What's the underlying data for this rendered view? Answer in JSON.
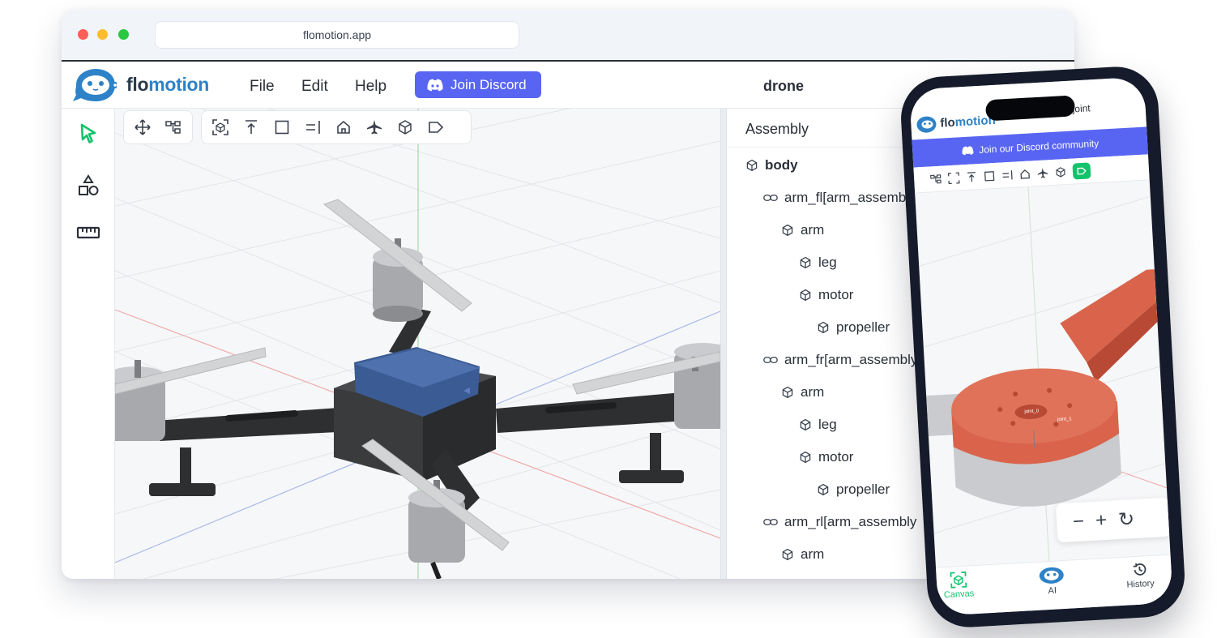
{
  "browser": {
    "url": "flomotion.app"
  },
  "app": {
    "brand_part1": "flo",
    "brand_part2": "motion",
    "menu": [
      "File",
      "Edit",
      "Help"
    ],
    "discord_label": "Join Discord",
    "doc_title": "drone"
  },
  "left_tools": [
    "select-cursor-icon",
    "shapes-icon",
    "ruler-icon"
  ],
  "toolbar": {
    "group1": [
      "move-icon",
      "hierarchy-icon"
    ],
    "group2": [
      "fit-view-icon",
      "top-view-icon",
      "front-view-icon",
      "side-view-icon",
      "home-view-icon",
      "plane-view-icon",
      "iso-cube-icon",
      "tag-icon"
    ]
  },
  "tree": {
    "header": "Assembly",
    "nodes": [
      {
        "label": "body",
        "type": "part",
        "level": 0,
        "bold": true
      },
      {
        "label": "arm_fl[arm_assembly",
        "type": "link",
        "level": 1
      },
      {
        "label": "arm",
        "type": "part",
        "level": 2
      },
      {
        "label": "leg",
        "type": "part",
        "level": 3
      },
      {
        "label": "motor",
        "type": "part",
        "level": 3
      },
      {
        "label": "propeller",
        "type": "part",
        "level": 4
      },
      {
        "label": "arm_fr[arm_assembly",
        "type": "link",
        "level": 1
      },
      {
        "label": "arm",
        "type": "part",
        "level": 2
      },
      {
        "label": "leg",
        "type": "part",
        "level": 3
      },
      {
        "label": "motor",
        "type": "part",
        "level": 3
      },
      {
        "label": "propeller",
        "type": "part",
        "level": 4
      },
      {
        "label": "arm_rl[arm_assembly",
        "type": "link",
        "level": 1
      },
      {
        "label": "arm",
        "type": "part",
        "level": 2
      }
    ]
  },
  "phone": {
    "brand_part1": "flo",
    "brand_part2": "motion",
    "title": "joint",
    "banner": "Join our Discord community",
    "joint_labels": [
      "joint_0",
      "joint_1"
    ],
    "zoom": [
      "−",
      "+",
      "↻"
    ],
    "nav": [
      {
        "label": "Canvas",
        "active": true
      },
      {
        "label": "AI",
        "active": false
      },
      {
        "label": "History",
        "active": false
      }
    ]
  },
  "colors": {
    "discord": "#5865f2",
    "accent_green": "#12c36b",
    "brand_blue": "#2e82c7",
    "drone_body": "#3a3b3d",
    "battery": "#3b5b95",
    "arm_orange": "#d9644b"
  }
}
